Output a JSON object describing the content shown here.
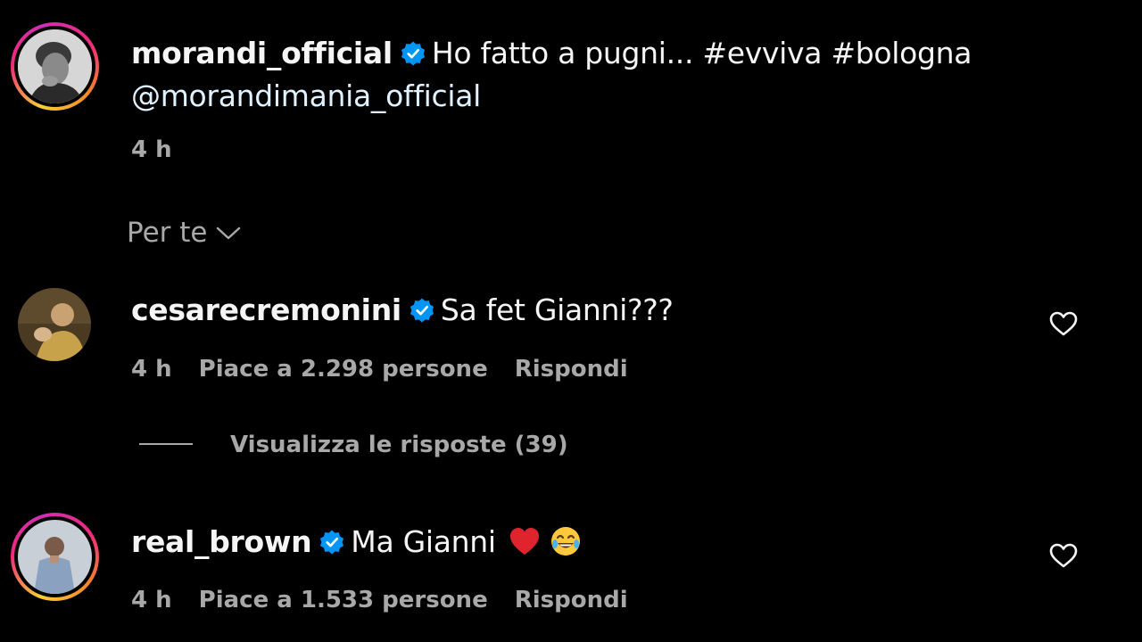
{
  "post": {
    "username": "morandi_official",
    "caption": "Ho fatto a pugni... #evviva #bologna",
    "mention": "@morandimania_official",
    "time": "4 h"
  },
  "filter": {
    "label": "Per te"
  },
  "comments": [
    {
      "username": "cesarecremonini",
      "text": "Sa fet Gianni???",
      "time": "4 h",
      "likes": "Piace a 2.298 persone",
      "reply": "Rispondi",
      "view_replies": "Visualizza le risposte (39)"
    },
    {
      "username": "real_brown",
      "text": "Ma Gianni",
      "emojis": [
        "red-heart-icon",
        "tears-of-joy-icon"
      ],
      "time": "4 h",
      "likes": "Piace a 1.533 persone",
      "reply": "Rispondi"
    }
  ],
  "colors": {
    "background": "#000000",
    "text": "#f5f5f5",
    "secondary": "#a8a8a8",
    "verified": "#0095f6"
  }
}
